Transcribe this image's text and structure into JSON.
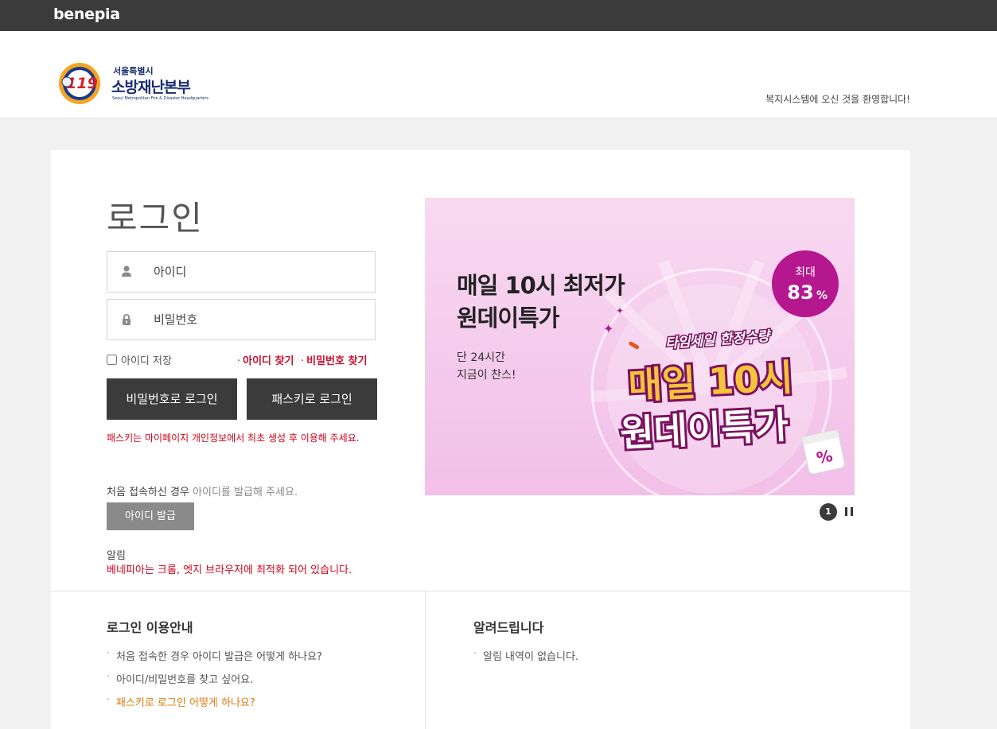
{
  "topbar": {
    "brand": "benepia"
  },
  "header": {
    "logo_small": "서울특별시",
    "logo_big": "소방재난본부",
    "logo_en": "Seoul Metropolitan Fire & Disaster Headquarters",
    "logo_emblem_text": "119",
    "welcome": "복지시스템에 오신 것을 환영합니다!"
  },
  "login": {
    "title": "로그인",
    "id_placeholder": "아이디",
    "pw_placeholder": "비밀번호",
    "remember_label": "아이디 저장",
    "find_id": "아이디 찾기",
    "find_pw": "비밀번호 찾기",
    "pw_login_button": "비밀번호로 로그인",
    "passkey_login_button": "패스키로 로그인",
    "passkey_note": "패스키는 마이페이지 개인정보에서 최초 생성 후 이용해 주세요.",
    "first_visit_prefix": "처음 접속하신 경우",
    "first_visit_suffix": "아이디를 발급해 주세요.",
    "issue_button": "아이디 발급",
    "notice_label": "알림",
    "notice_text": "베네피아는 크롬, 엣지 브라우저에 최적화 되어 있습니다."
  },
  "banner": {
    "headline_1": "매일 10시 최저가",
    "headline_2": "원데이특가",
    "sub_1": "단 24시간",
    "sub_2": "지금이 찬스!",
    "badge_top": "최대",
    "badge_value": "83",
    "badge_unit": "%",
    "ribbon": "타임세일 한정수량",
    "big_1": "매일 10시",
    "big_2": "원데이특가",
    "calendar_symbol": "%",
    "colors": {
      "bg": "#f4c6ec",
      "badge": "#b5178f",
      "big_text": "#f5c43a",
      "big_stroke": "#7a1260"
    }
  },
  "pager": {
    "current": "1"
  },
  "guide": {
    "title": "로그인 이용안내",
    "items": [
      "처음 접속한 경우 아이디 발급은 어떻게 하나요?",
      "아이디/비밀번호를 찾고 싶어요.",
      "패스키로 로그인 어떻게 하나요?"
    ]
  },
  "notify": {
    "title": "알려드립니다",
    "items": [
      "알림 내역이 없습니다."
    ]
  }
}
